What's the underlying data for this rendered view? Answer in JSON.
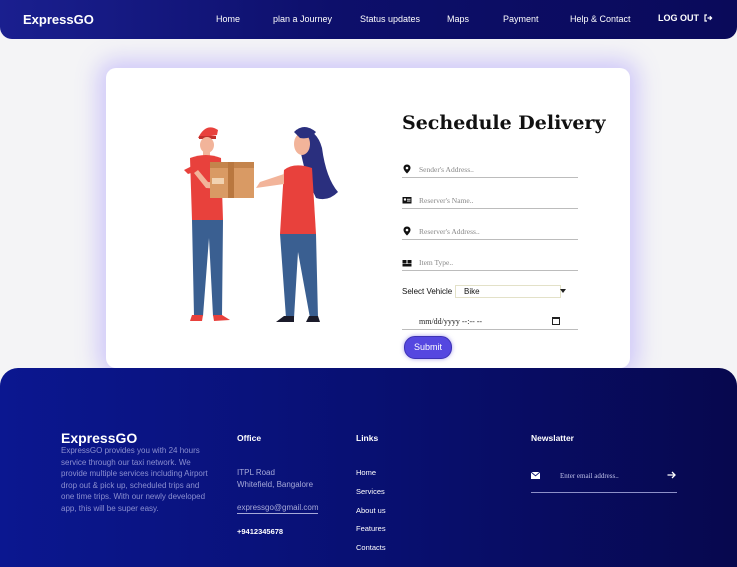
{
  "nav": {
    "brand": "ExpressGO",
    "links": [
      "Home",
      "plan a Journey",
      "Status updates",
      "Maps",
      "Payment",
      "Help & Contact"
    ],
    "logout": "LOG OUT"
  },
  "form": {
    "title": "Sechedule Delivery",
    "fields": [
      {
        "placeholder": "Sender's Address..",
        "icon": "map-marker-icon"
      },
      {
        "placeholder": "Reserver's Name..",
        "icon": "id-card-icon"
      },
      {
        "placeholder": "Reserver's Address..",
        "icon": "map-marker-icon"
      },
      {
        "placeholder": "Item Type..",
        "icon": "boxes-icon"
      }
    ],
    "vehicle_label": "Select Vehicle :",
    "vehicle_value": "Bike",
    "date_placeholder": "mm/dd/yyyy --:-- --",
    "submit": "Submit"
  },
  "footer": {
    "brand": "ExpressGO",
    "about": "ExpressGO provides you with 24 hours service through our taxi network. We provide multiple services including Airport drop out & pick up, scheduled trips and one time trips. With our newly developed app, this will be super easy.",
    "office": {
      "heading": "Office",
      "line1": "ITPL Road",
      "line2": "Whitefield, Bangalore",
      "email": "expressgo@gmail.com",
      "phone": "+9412345678"
    },
    "links": {
      "heading": "Links",
      "items": [
        "Home",
        "Services",
        "About us",
        "Features",
        "Contacts"
      ]
    },
    "newsletter": {
      "heading": "Newslatter",
      "placeholder": "Enter email address.."
    }
  },
  "colors": {
    "nav_bg": "#0d0f6b",
    "footer_bg": "#080f6f",
    "accent": "#5547e0",
    "shirt": "#e8413c",
    "jeans": "#3a5f91"
  }
}
